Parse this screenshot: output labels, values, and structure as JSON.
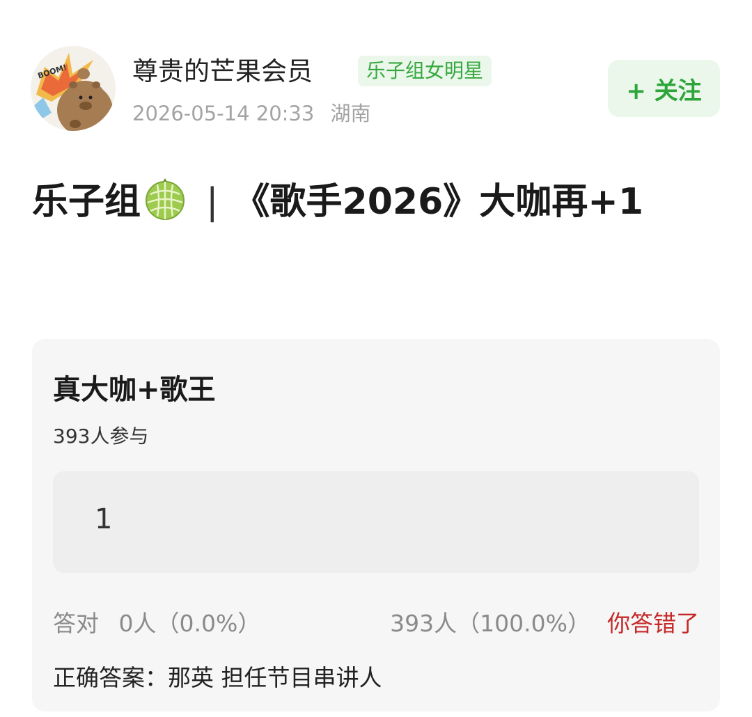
{
  "header": {
    "username": "尊贵的芒果会员",
    "tag": "乐子组女明星",
    "date": "2026-05-14 20:33",
    "location": "湖南",
    "follow_label": "+ 关注",
    "avatar_text": "BOOM!"
  },
  "post": {
    "title_start": "乐子组",
    "title_sep": "|",
    "title_end": "《歌手2026》大咖再+1",
    "title_emoji": "melon-icon"
  },
  "poll": {
    "question": "真大咖+歌王",
    "participants": "393人参与",
    "option_label": "1",
    "correct_label": "答对",
    "correct_stats": "0人（0.0%）",
    "option_stats": "393人（100.0%）",
    "result": "你答错了",
    "answer": "正确答案：那英 担任节目串讲人",
    "correct_fraction": 0.0,
    "option_fraction": 1.0
  },
  "colors": {
    "accent_green": "#2ea53a",
    "tag_bg": "#eaf7ea",
    "wrong_red": "#c62828"
  }
}
